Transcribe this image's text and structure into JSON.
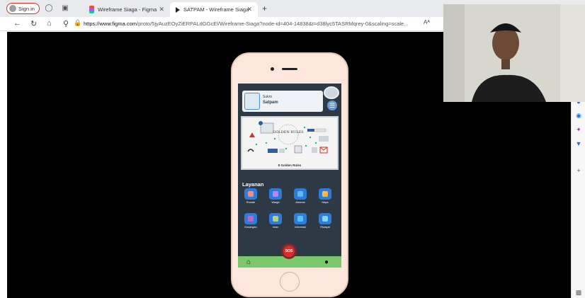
{
  "browser": {
    "signin_label": "Sign in",
    "tabs": [
      {
        "title": "Wireframe Siaga - Figma"
      },
      {
        "title": "SATPAM - Wireframe Siaga"
      }
    ],
    "url_host": "https://www.figma.com",
    "url_path": "/proto/5jyAuzEOyZiERPALdGGcEl/Wireframe-Siaga?node-id=404-14838&t=d38lyc5TASRMqrey-0&scaling=scale...",
    "reader_label": "Aᴬ"
  },
  "app": {
    "profile": {
      "name": "Sukro",
      "role": "Satpam"
    },
    "card_caption": "8 Golden Rules",
    "card_center_text": "GOLDEN RULES",
    "section_title": "Layanan",
    "services": [
      {
        "label": "Rumah",
        "color": "#2f7bd8",
        "accent": "#f28b82"
      },
      {
        "label": "Warga",
        "color": "#2f7bd8",
        "accent": "#b388ff"
      },
      {
        "label": "Absensi",
        "color": "#2f7bd8",
        "accent": "#64b5f6"
      },
      {
        "label": "Maps",
        "color": "#2f7bd8",
        "accent": "#ffb74d"
      },
      {
        "label": "Keuangan",
        "color": "#2f7bd8",
        "accent": "#ba68c8"
      },
      {
        "label": "Iuran",
        "color": "#2f7bd8",
        "accent": "#aed581"
      },
      {
        "label": "Informasi",
        "color": "#2f7bd8",
        "accent": "#4fc3f7"
      },
      {
        "label": "Riwayat",
        "color": "#2f7bd8",
        "accent": "#81d4fa"
      }
    ],
    "sos_label": "SOS"
  }
}
